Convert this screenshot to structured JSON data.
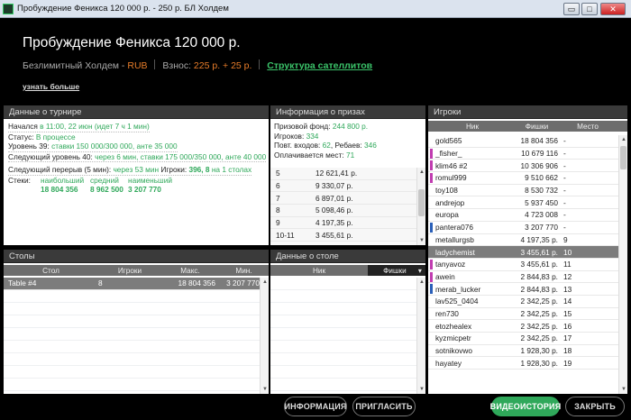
{
  "window": {
    "title": "Пробуждение Феникса 120 000 р. - 250 р. БЛ Холдем",
    "min": "▭",
    "max": "□",
    "close": "✕"
  },
  "header": {
    "title": "Пробуждение Феникса 120 000 р.",
    "game": "Безлимитный Холдем",
    "dash": " - ",
    "currency": "RUB",
    "buyin_label": "Взнос:",
    "buyin": "225 р. + 25 р.",
    "satellites": "Структура сателлитов",
    "more": "узнать больше"
  },
  "info": {
    "title": "Данные о турнире",
    "started_label": "Начался ",
    "started": "в 11:00, 22 июн (идет 7 ч 1 мин)",
    "status_label": "Статус: ",
    "status": "В процессе",
    "level_label": "Уровень 39: ",
    "level": "ставки 150 000/300 000",
    "level_ante": ", анте 35 000",
    "next_label": "Следующий уровень 40: ",
    "next_in": "через 6 мин",
    "next_blinds": ", ставки 175 000/350 000",
    "next_ante": ", анте 40 000",
    "break_label": "Следующий перерыв (5 мин): ",
    "break_in": "через 53 мин",
    "players_label": "Игроки: ",
    "players": "396",
    "players_mid": ", 8",
    "players_tables": " на 1 столах",
    "stacks_label": "Стеки:",
    "stack_max_label": "наибольший",
    "stack_avg_label": "средний",
    "stack_min_label": "наименьший",
    "stack_max": "18 804 356",
    "stack_avg": "8 962 500",
    "stack_min": "3 207 770"
  },
  "prize": {
    "title": "Информация о призах",
    "pool_label": "Призовой фонд: ",
    "pool": "244 800 р.",
    "entrants_label": "Игроков: ",
    "entrants": "334",
    "reentry_label": "Повт. входов: ",
    "reentry": "62",
    "rebuy_label": ", Ребаев: ",
    "rebuy": "346",
    "paid_label": "Оплачивается мест: ",
    "paid": "71",
    "rows": [
      {
        "place": "5",
        "amount": "12 621,41 р."
      },
      {
        "place": "6",
        "amount": "9 330,07 р."
      },
      {
        "place": "7",
        "amount": "6 897,01 р."
      },
      {
        "place": "8",
        "amount": "5 098,46 р."
      },
      {
        "place": "9",
        "amount": "4 197,35 р."
      },
      {
        "place": "10-11",
        "amount": "3 455,61 р."
      }
    ]
  },
  "players": {
    "title": "Игроки",
    "col_nick": "Ник",
    "col_chips": "Фишки",
    "col_place": "Место",
    "rows": [
      {
        "nick": "gold565",
        "chips": "18 804 356",
        "place": "-",
        "mark": ""
      },
      {
        "nick": "_fisher_",
        "chips": "10 679 116",
        "place": "-",
        "mark": "#c03cb0"
      },
      {
        "nick": "klim46 #2",
        "chips": "10 306 906",
        "place": "-",
        "mark": "#c03cb0"
      },
      {
        "nick": "romul999",
        "chips": "9 510 662",
        "place": "-",
        "mark": "#c03cb0"
      },
      {
        "nick": "toy108",
        "chips": "8 530 732",
        "place": "-",
        "mark": ""
      },
      {
        "nick": "andrejop",
        "chips": "5 937 450",
        "place": "-",
        "mark": ""
      },
      {
        "nick": "europa",
        "chips": "4 723 008",
        "place": "-",
        "mark": ""
      },
      {
        "nick": "pantera076",
        "chips": "3 207 770",
        "place": "-",
        "mark": "#2a5fb8"
      },
      {
        "nick": "metallurgsb",
        "chips": "4 197,35 р.",
        "place": "9",
        "mark": ""
      },
      {
        "nick": "ladychemist",
        "chips": "3 455,61 р.",
        "place": "10",
        "mark": "",
        "sel": true
      },
      {
        "nick": "tanyavoz",
        "chips": "3 455,61 р.",
        "place": "11",
        "mark": "#c03cb0"
      },
      {
        "nick": "awein",
        "chips": "2 844,83 р.",
        "place": "12",
        "mark": "#c03cb0"
      },
      {
        "nick": "merab_lucker",
        "chips": "2 844,83 р.",
        "place": "13",
        "mark": "#2a5fb8"
      },
      {
        "nick": "lav525_0404",
        "chips": "2 342,25 р.",
        "place": "14",
        "mark": ""
      },
      {
        "nick": "ren730",
        "chips": "2 342,25 р.",
        "place": "15",
        "mark": ""
      },
      {
        "nick": "etozhealex",
        "chips": "2 342,25 р.",
        "place": "16",
        "mark": ""
      },
      {
        "nick": "kyzmicpetr",
        "chips": "2 342,25 р.",
        "place": "17",
        "mark": ""
      },
      {
        "nick": "sotnikovwo",
        "chips": "1 928,30 р.",
        "place": "18",
        "mark": ""
      },
      {
        "nick": "hayatey",
        "chips": "1 928,30 р.",
        "place": "19",
        "mark": ""
      }
    ]
  },
  "tables": {
    "title": "Столы",
    "col_table": "Стол",
    "col_players": "Игроки",
    "col_max": "Макс.",
    "col_min": "Мин.",
    "rows": [
      {
        "table": "Table #4",
        "players": "8",
        "max": "18 804 356",
        "min": "3 207 770"
      }
    ]
  },
  "tabledata": {
    "title": "Данные о столе",
    "col_nick": "Ник",
    "col_chips": "Фишки",
    "sort_icon": "▾"
  },
  "buttons": {
    "info": "ИНФОРМАЦИЯ",
    "invite": "ПРИГЛАСИТЬ",
    "video": "ВИДЕОИСТОРИЯ",
    "close": "ЗАКРЫТЬ"
  }
}
